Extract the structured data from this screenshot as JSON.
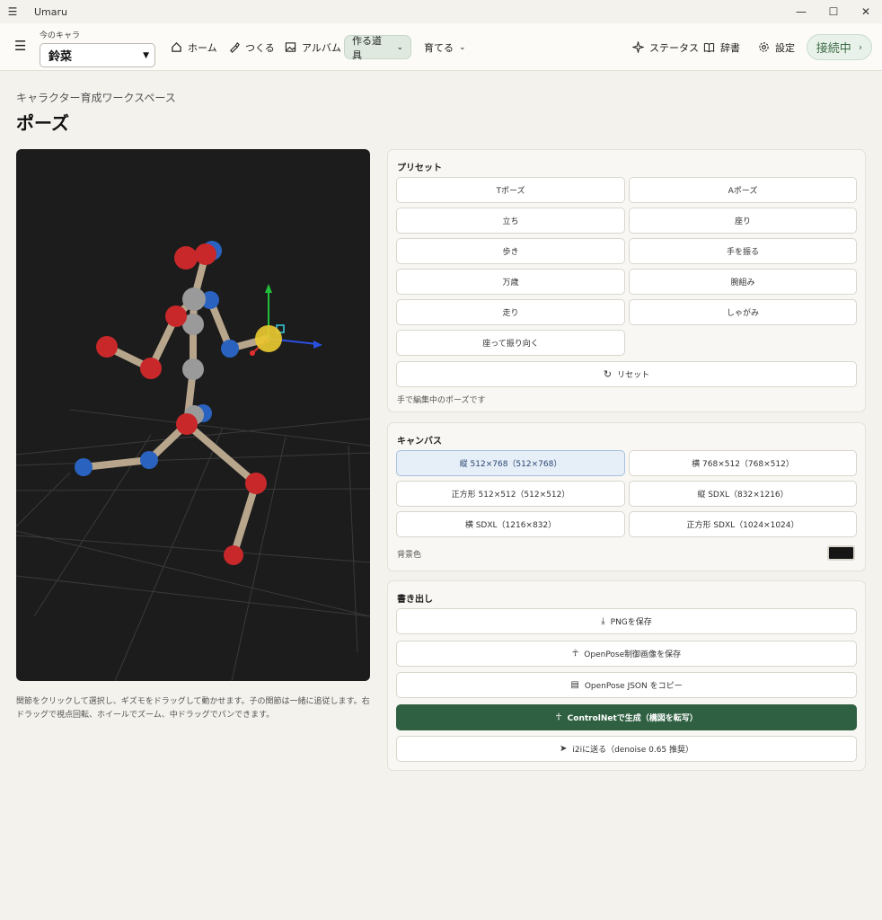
{
  "window": {
    "title": "Umaru"
  },
  "nav": {
    "char_label": "今のキャラ",
    "char_value": "鈴菜",
    "items": [
      {
        "label": "ホーム",
        "icon": "home-icon"
      },
      {
        "label": "つくる",
        "icon": "brush-icon"
      },
      {
        "label": "アルバム",
        "icon": "image-icon"
      },
      {
        "label": "作る道具",
        "icon": "chevron-down-icon"
      },
      {
        "label": "育てる",
        "icon": "chevron-down-icon"
      },
      {
        "label": "ステータス",
        "icon": "sparkle-icon"
      },
      {
        "label": "辞書",
        "icon": "book-icon"
      },
      {
        "label": "設定",
        "icon": "gear-icon"
      }
    ],
    "connection": "接続中"
  },
  "page": {
    "subtitle": "キャラクター育成ワークスペース",
    "title": "ポーズ",
    "help": "関節をクリックして選択し、ギズモをドラッグして動かせます。子の関節は一緒に追従します。右ドラッグで視点回転、ホイールでズーム、中ドラッグでパンできます。"
  },
  "presets": {
    "heading": "プリセット",
    "items": [
      "Tポーズ",
      "Aポーズ",
      "立ち",
      "座り",
      "歩き",
      "手を振る",
      "万歳",
      "腕組み",
      "走り",
      "しゃがみ",
      "座って振り向く"
    ],
    "reset": "リセット",
    "status": "手で編集中のポーズです"
  },
  "canvas": {
    "heading": "キャンバス",
    "sizes": [
      "縦 512×768（512×768）",
      "横 768×512（768×512）",
      "正方形 512×512（512×512）",
      "縦 SDXL（832×1216）",
      "横 SDXL（1216×832）",
      "正方形 SDXL（1024×1024）"
    ],
    "selected": 0,
    "bg_label": "背景色",
    "bg_color": "#151515"
  },
  "export": {
    "heading": "書き出し",
    "save_png": "PNGを保存",
    "save_openpose": "OpenPose制御画像を保存",
    "copy_json": "OpenPose JSON をコピー",
    "controlnet": "ControlNetで生成（構図を転写）",
    "i2i": "i2iに送る（denoise 0.65 推奨）"
  },
  "colors": {
    "primary": "#2f6042",
    "accent_bg": "#dfe9e0",
    "joint_red": "#c8282a",
    "joint_blue": "#2a62c0",
    "joint_gray": "#9a9a9a",
    "bone": "#b8a68c"
  }
}
